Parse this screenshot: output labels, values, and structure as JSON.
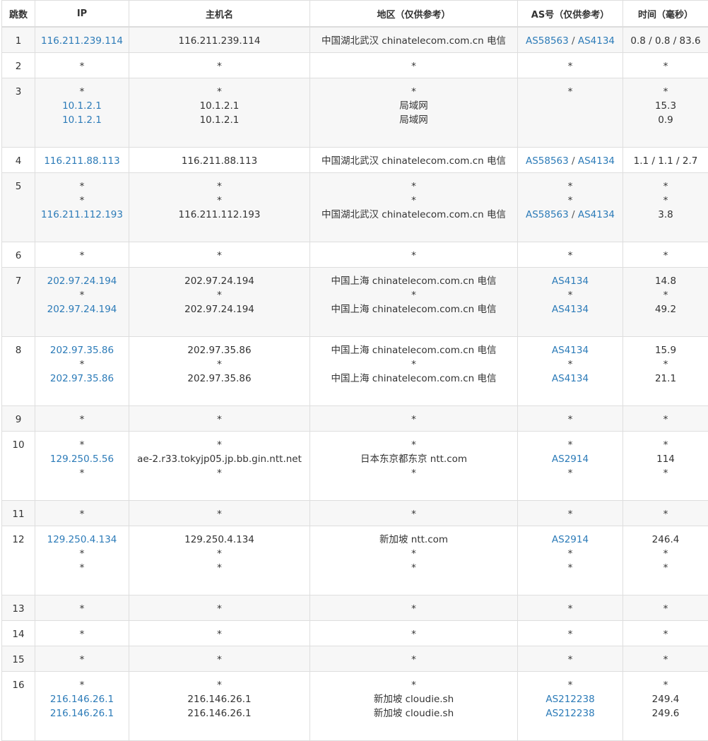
{
  "headers": {
    "hop": "跳数",
    "ip": "IP",
    "hostname": "主机名",
    "region": "地区（仅供参考）",
    "asn": "AS号（仅供参考）",
    "time": "时间（毫秒）"
  },
  "colors": {
    "link": "#2c7bb8",
    "text": "#333333",
    "border": "#dedede",
    "stripe": "#f7f7f7"
  },
  "rows": [
    {
      "hop": "1",
      "ip": [
        "116.211.239.114"
      ],
      "host": [
        "116.211.239.114"
      ],
      "region": [
        "中国湖北武汉 chinatelecom.com.cn 电信"
      ],
      "asn": [
        [
          "AS58563",
          "AS4134"
        ]
      ],
      "time": [
        "0.8 / 0.8 / 83.6"
      ]
    },
    {
      "hop": "2",
      "ip": [
        "*"
      ],
      "host": [
        "*"
      ],
      "region": [
        "*"
      ],
      "asn": [
        [
          "*"
        ]
      ],
      "time": [
        "*"
      ]
    },
    {
      "hop": "3",
      "ip": [
        "*",
        "10.1.2.1",
        "10.1.2.1"
      ],
      "host": [
        "*",
        "10.1.2.1",
        "10.1.2.1"
      ],
      "region": [
        "*",
        "局域网",
        "局域网"
      ],
      "asn": [
        [
          "*"
        ],
        [],
        []
      ],
      "time": [
        "*",
        "15.3",
        "0.9"
      ]
    },
    {
      "hop": "4",
      "ip": [
        "116.211.88.113"
      ],
      "host": [
        "116.211.88.113"
      ],
      "region": [
        "中国湖北武汉 chinatelecom.com.cn 电信"
      ],
      "asn": [
        [
          "AS58563",
          "AS4134"
        ]
      ],
      "time": [
        "1.1 / 1.1 / 2.7"
      ]
    },
    {
      "hop": "5",
      "ip": [
        "*",
        "*",
        "116.211.112.193"
      ],
      "host": [
        "*",
        "*",
        "116.211.112.193"
      ],
      "region": [
        "*",
        "*",
        "中国湖北武汉 chinatelecom.com.cn 电信"
      ],
      "asn": [
        [
          "*"
        ],
        [
          "*"
        ],
        [
          "AS58563",
          "AS4134"
        ]
      ],
      "time": [
        "*",
        "*",
        "3.8"
      ]
    },
    {
      "hop": "6",
      "ip": [
        "*"
      ],
      "host": [
        "*"
      ],
      "region": [
        "*"
      ],
      "asn": [
        [
          "*"
        ]
      ],
      "time": [
        "*"
      ]
    },
    {
      "hop": "7",
      "ip": [
        "202.97.24.194",
        "*",
        "202.97.24.194"
      ],
      "host": [
        "202.97.24.194",
        "*",
        "202.97.24.194"
      ],
      "region": [
        "中国上海 chinatelecom.com.cn 电信",
        "*",
        "中国上海 chinatelecom.com.cn 电信"
      ],
      "asn": [
        [
          "AS4134"
        ],
        [
          "*"
        ],
        [
          "AS4134"
        ]
      ],
      "time": [
        "14.8",
        "*",
        "49.2"
      ]
    },
    {
      "hop": "8",
      "ip": [
        "202.97.35.86",
        "*",
        "202.97.35.86"
      ],
      "host": [
        "202.97.35.86",
        "*",
        "202.97.35.86"
      ],
      "region": [
        "中国上海 chinatelecom.com.cn 电信",
        "*",
        "中国上海 chinatelecom.com.cn 电信"
      ],
      "asn": [
        [
          "AS4134"
        ],
        [
          "*"
        ],
        [
          "AS4134"
        ]
      ],
      "time": [
        "15.9",
        "*",
        "21.1"
      ]
    },
    {
      "hop": "9",
      "ip": [
        "*"
      ],
      "host": [
        "*"
      ],
      "region": [
        "*"
      ],
      "asn": [
        [
          "*"
        ]
      ],
      "time": [
        "*"
      ]
    },
    {
      "hop": "10",
      "ip": [
        "*",
        "129.250.5.56",
        "*"
      ],
      "host": [
        "*",
        "ae-2.r33.tokyjp05.jp.bb.gin.ntt.net",
        "*"
      ],
      "region": [
        "*",
        "日本东京都东京 ntt.com",
        "*"
      ],
      "asn": [
        [
          "*"
        ],
        [
          "AS2914"
        ],
        [
          "*"
        ]
      ],
      "time": [
        "*",
        "114",
        "*"
      ]
    },
    {
      "hop": "11",
      "ip": [
        "*"
      ],
      "host": [
        "*"
      ],
      "region": [
        "*"
      ],
      "asn": [
        [
          "*"
        ]
      ],
      "time": [
        "*"
      ]
    },
    {
      "hop": "12",
      "ip": [
        "129.250.4.134",
        "*",
        "*"
      ],
      "host": [
        "129.250.4.134",
        "*",
        "*"
      ],
      "region": [
        "新加坡 ntt.com",
        "*",
        "*"
      ],
      "asn": [
        [
          "AS2914"
        ],
        [
          "*"
        ],
        [
          "*"
        ]
      ],
      "time": [
        "246.4",
        "*",
        "*"
      ]
    },
    {
      "hop": "13",
      "ip": [
        "*"
      ],
      "host": [
        "*"
      ],
      "region": [
        "*"
      ],
      "asn": [
        [
          "*"
        ]
      ],
      "time": [
        "*"
      ]
    },
    {
      "hop": "14",
      "ip": [
        "*"
      ],
      "host": [
        "*"
      ],
      "region": [
        "*"
      ],
      "asn": [
        [
          "*"
        ]
      ],
      "time": [
        "*"
      ]
    },
    {
      "hop": "15",
      "ip": [
        "*"
      ],
      "host": [
        "*"
      ],
      "region": [
        "*"
      ],
      "asn": [
        [
          "*"
        ]
      ],
      "time": [
        "*"
      ]
    },
    {
      "hop": "16",
      "ip": [
        "*",
        "216.146.26.1",
        "216.146.26.1"
      ],
      "host": [
        "*",
        "216.146.26.1",
        "216.146.26.1"
      ],
      "region": [
        "*",
        "新加坡 cloudie.sh",
        "新加坡 cloudie.sh"
      ],
      "asn": [
        [
          "*"
        ],
        [
          "AS212238"
        ],
        [
          "AS212238"
        ]
      ],
      "time": [
        "*",
        "249.4",
        "249.6"
      ]
    }
  ]
}
